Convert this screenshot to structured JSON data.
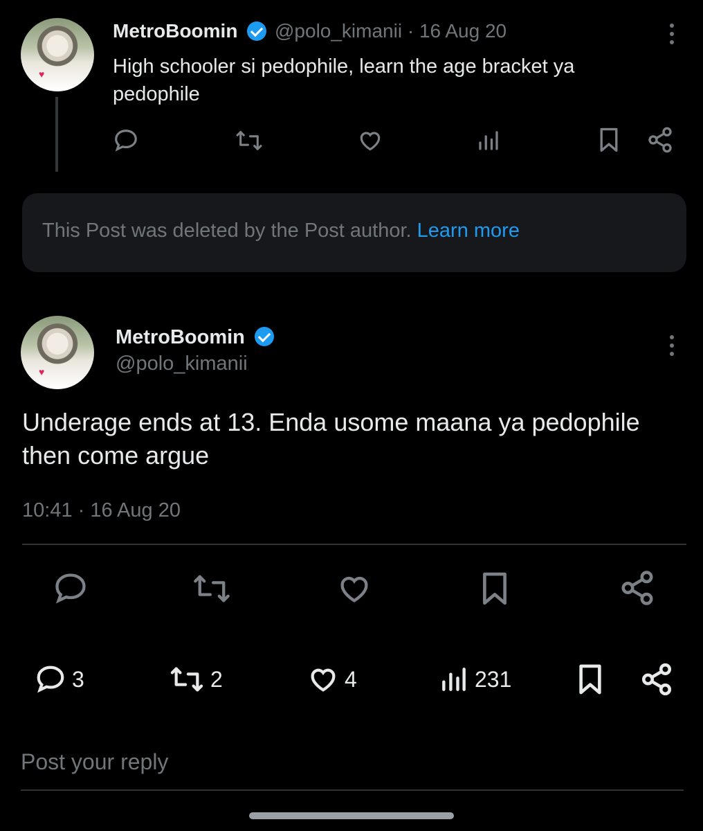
{
  "parent_tweet": {
    "display_name": "MetroBoomin",
    "handle": "@polo_kimanii",
    "separator": "·",
    "date": "16 Aug 20",
    "text_line1": "High schooler si pedophile, learn the age bracket ya",
    "text_line2": "pedophile"
  },
  "deleted_notice": {
    "text": "This Post was deleted by the Post author.",
    "link": "Learn more"
  },
  "main_tweet": {
    "display_name": "MetroBoomin",
    "handle": "@polo_kimanii",
    "text_line1": "Underage ends at 13. Enda usome maana ya pedophile",
    "text_line2": "then come argue",
    "timestamp": "10:41 · 16 Aug 20"
  },
  "stats": {
    "replies": "3",
    "reposts": "2",
    "likes": "4",
    "views": "231"
  },
  "reply_box": {
    "placeholder": "Post your reply"
  },
  "colors": {
    "background": "#000000",
    "accent": "#1d9bf0",
    "text": "#e7e9ea",
    "muted": "#71767b",
    "card": "#16181c"
  },
  "icons": [
    "reply-icon",
    "repost-icon",
    "like-icon",
    "views-icon",
    "bookmark-icon",
    "share-icon",
    "more-icon",
    "verified-badge-icon"
  ]
}
